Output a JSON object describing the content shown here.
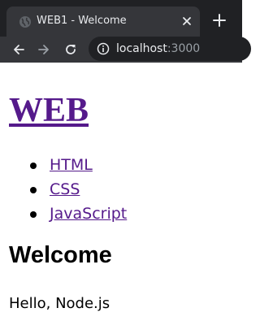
{
  "browser": {
    "tab": {
      "title": "WEB1 - Welcome",
      "icon": "globe-icon"
    },
    "url": {
      "host": "localhost",
      "port": ":3000"
    },
    "colors": {
      "frame": "#202124",
      "toolbar": "#35363a",
      "text": "#e8eaed",
      "muted": "#9aa0a6"
    }
  },
  "page": {
    "site_title": "WEB",
    "nav_links": [
      {
        "label": "HTML"
      },
      {
        "label": "CSS"
      },
      {
        "label": "JavaScript"
      }
    ],
    "heading": "Welcome",
    "body": "Hello, Node.js",
    "colors": {
      "link": "#551a8b",
      "text": "#000000"
    }
  }
}
